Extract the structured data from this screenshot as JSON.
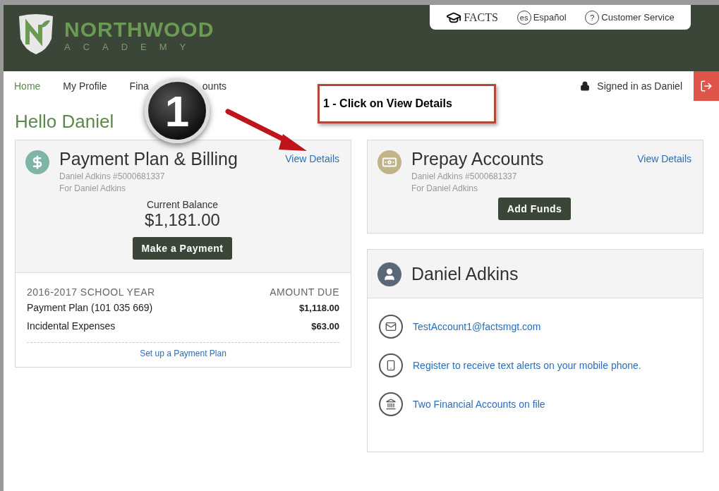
{
  "header": {
    "logo_name": "NORTHWOOD",
    "logo_subtitle": "ACADEMY",
    "top_links": [
      {
        "kind": "brand",
        "label": "FACTS"
      },
      {
        "kind": "language",
        "badge": "es",
        "label": "Español"
      },
      {
        "kind": "help",
        "badge": "?",
        "label": "Customer Service"
      }
    ]
  },
  "nav": {
    "items": [
      {
        "label": "Home",
        "selected": true
      },
      {
        "label": "My Profile",
        "selected": false
      },
      {
        "label": "Fina",
        "label_end": "ounts",
        "selected": false
      }
    ],
    "signed_in": "Signed in as Daniel"
  },
  "annotation": {
    "badge": "1",
    "callout": "1 - Click on View Details"
  },
  "greeting": "Hello Daniel",
  "billing": {
    "title": "Payment Plan & Billing",
    "link": "View Details",
    "account": "Daniel Adkins #5000681337",
    "for": "For Daniel Adkins",
    "balance_label": "Current Balance",
    "balance": "$1,181.00",
    "button": "Make a Payment",
    "year": "2016-2017 SCHOOL YEAR",
    "amount_header": "AMOUNT DUE",
    "rows": [
      {
        "label": "Payment Plan (101 035 669)",
        "amount": "$1,118.00"
      },
      {
        "label": "Incidental Expenses",
        "amount": "$63.00"
      }
    ],
    "footer_link": "Set up a Payment Plan"
  },
  "prepay": {
    "title": "Prepay Accounts",
    "link": "View Details",
    "account": "Daniel Adkins #5000681337",
    "for": "For Daniel Adkins",
    "button": "Add Funds"
  },
  "profile": {
    "name": "Daniel Adkins",
    "items": [
      {
        "kind": "email",
        "label": "TestAccount1@factsmgt.com"
      },
      {
        "kind": "phone",
        "label": "Register to receive text alerts on your mobile phone."
      },
      {
        "kind": "bank",
        "label": "Two Financial Accounts on file"
      }
    ]
  }
}
